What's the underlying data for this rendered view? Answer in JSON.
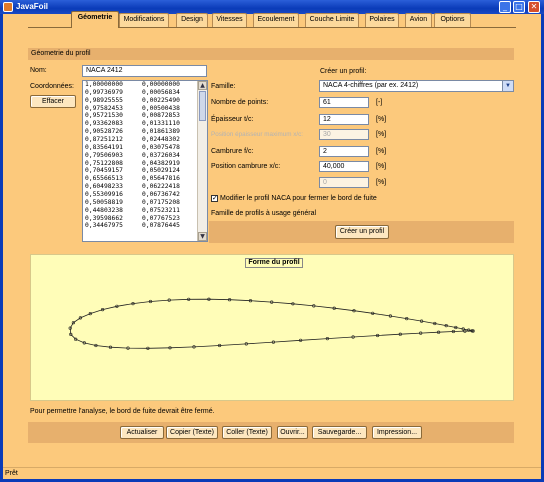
{
  "window": {
    "title": "JavaFoil",
    "min": "_",
    "max": "□",
    "close": "✕"
  },
  "tabs": [
    {
      "label": "Géometrie",
      "active": true
    },
    {
      "label": "Modifications"
    },
    {
      "label": "Design"
    },
    {
      "label": "Vitesses"
    },
    {
      "label": "Ecoulement"
    },
    {
      "label": "Couche Limite"
    },
    {
      "label": "Polaires"
    },
    {
      "label": "Avion"
    },
    {
      "label": "Options"
    }
  ],
  "geometry": {
    "section_title": "Géometrie du profil",
    "name_label": "Nom:",
    "name_value": "NACA 2412",
    "coords_label": "Coordonnées:",
    "clear_button": "Effacer",
    "coordinates": [
      [
        "1,00000000",
        "0,00000000"
      ],
      [
        "0,99736979",
        "0,00056834"
      ],
      [
        "0,98925555",
        "0,00225490"
      ],
      [
        "0,97582453",
        "0,00500438"
      ],
      [
        "0,95721530",
        "0,00872853"
      ],
      [
        "0,93362083",
        "0,01331110"
      ],
      [
        "0,90528726",
        "0,01861389"
      ],
      [
        "0,87251212",
        "0,02448302"
      ],
      [
        "0,83564191",
        "0,03075478"
      ],
      [
        "0,79506903",
        "0,03726034"
      ],
      [
        "0,75122808",
        "0,04382919"
      ],
      [
        "0,70459157",
        "0,05029124"
      ],
      [
        "0,65566513",
        "0,05647816"
      ],
      [
        "0,60498233",
        "0,06222418"
      ],
      [
        "0,55309916",
        "0,06736742"
      ],
      [
        "0,50058819",
        "0,07175208"
      ],
      [
        "0,44803238",
        "0,07523211"
      ],
      [
        "0,39598662",
        "0,07767523"
      ],
      [
        "0,34467975",
        "0,07876445"
      ]
    ]
  },
  "create": {
    "title": "Créer un profil:",
    "family_label": "Famille:",
    "family_value": "NACA 4-chiffres (par ex. 2412)",
    "params": [
      {
        "label": "Nombre de points:",
        "value": "61",
        "unit": "[-]",
        "disabled": false
      },
      {
        "label": "Épaisseur t/c:",
        "value": "12",
        "unit": "[%]",
        "disabled": false
      },
      {
        "label": "Position épaisseur maximum  x/c:",
        "value": "30",
        "unit": "[%]",
        "disabled": true
      },
      {
        "label": "Cambrure  f/c:",
        "value": "2",
        "unit": "[%]",
        "disabled": false
      },
      {
        "label": "Position cambrure  x/c:",
        "value": "40,000",
        "unit": "[%]",
        "disabled": false
      },
      {
        "label": "",
        "value": "0",
        "unit": "[%]",
        "disabled": true
      }
    ],
    "modify_checkbox_label": "Modifier le profil NACA pour fermer le bord de fuite",
    "modify_checked": true,
    "family_description": "Famille de profils à usage général",
    "create_button": "Créer un profil"
  },
  "plot": {
    "title": "Forme du profil"
  },
  "chart_data": {
    "type": "line",
    "title": "Forme du profil",
    "xlabel": "",
    "ylabel": "",
    "xlim": [
      0,
      1
    ],
    "ylim": [
      -0.05,
      0.1
    ],
    "grid": false,
    "series": [
      {
        "x": [
          1,
          0.9974,
          0.9893,
          0.9758,
          0.9572,
          0.9336,
          0.9053,
          0.8725,
          0.8356,
          0.7951,
          0.7512,
          0.7046,
          0.6557,
          0.605,
          0.5531,
          0.5006,
          0.448,
          0.396,
          0.3447,
          0.2946,
          0.2461,
          0.1998,
          0.1564,
          0.1165,
          0.0809,
          0.0503,
          0.0257,
          0.0085,
          0.0005,
          0.0021,
          0.0141,
          0.0354,
          0.0643,
          0.1006,
          0.1438,
          0.1932,
          0.2482,
          0.3078,
          0.3712,
          0.4374,
          0.5048,
          0.5723,
          0.6386,
          0.7026,
          0.7633,
          0.8195,
          0.8703,
          0.9146,
          0.9514,
          0.9799,
          1
        ],
        "y": [
          0,
          0.0006,
          0.0023,
          0.005,
          0.0087,
          0.0133,
          0.0186,
          0.0245,
          0.0308,
          0.0373,
          0.0438,
          0.0503,
          0.0565,
          0.0622,
          0.0674,
          0.0718,
          0.0752,
          0.0777,
          0.0788,
          0.0786,
          0.0767,
          0.0732,
          0.0681,
          0.0613,
          0.053,
          0.0433,
          0.0324,
          0.0205,
          0.0072,
          -0.0084,
          -0.0203,
          -0.0295,
          -0.0361,
          -0.0403,
          -0.0425,
          -0.0429,
          -0.0418,
          -0.0394,
          -0.0361,
          -0.032,
          -0.0276,
          -0.0232,
          -0.0189,
          -0.0149,
          -0.0112,
          -0.0079,
          -0.0051,
          -0.0029,
          -0.0013,
          -0.0003,
          0
        ]
      }
    ]
  },
  "bottom": {
    "note": "Pour permettre l'analyse, le bord de fuite devrait être fermé.",
    "buttons": [
      "Actualiser",
      "Copier (Texte)",
      "Coller (Texte)",
      "Ouvrir...",
      "Sauvegarde...",
      "Impression..."
    ]
  },
  "status": "Prêt"
}
